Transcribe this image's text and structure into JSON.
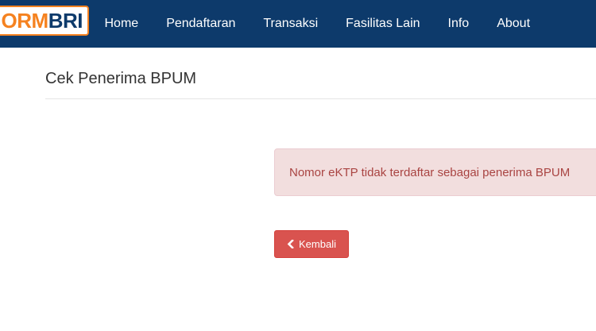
{
  "brand": {
    "logo_part_a": "ORM",
    "logo_part_b": "BRI"
  },
  "nav": {
    "items": [
      {
        "label": "Home"
      },
      {
        "label": "Pendaftaran"
      },
      {
        "label": "Transaksi"
      },
      {
        "label": "Fasilitas Lain"
      },
      {
        "label": "Info"
      },
      {
        "label": "About"
      }
    ]
  },
  "page": {
    "title": "Cek Penerima BPUM"
  },
  "alert": {
    "message": "Nomor eKTP tidak terdaftar sebagai penerima BPUM"
  },
  "actions": {
    "back_label": "Kembali",
    "back_icon": "chevron-left-icon"
  },
  "colors": {
    "navbar": "#0d3a6b",
    "logo_orange": "#f58220",
    "alert_bg": "#f2dede",
    "alert_text": "#a94442",
    "danger_button": "#d9534f"
  }
}
